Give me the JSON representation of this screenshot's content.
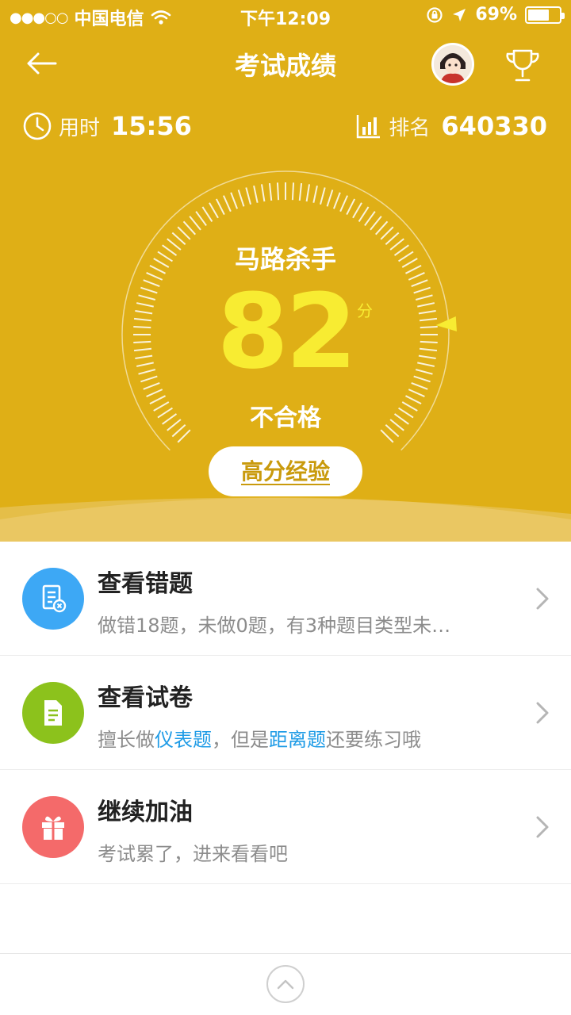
{
  "status_bar": {
    "carrier": "中国电信",
    "signal": "●●●○○",
    "time": "下午12:09",
    "battery": "69%",
    "battery_level": 0.69
  },
  "nav": {
    "title": "考试成绩"
  },
  "stats": {
    "time_label": "用时",
    "time_value": "15:56",
    "rank_label": "排名",
    "rank_value": "640330"
  },
  "result": {
    "level": "马路杀手",
    "score": "82",
    "score_unit": "分",
    "status": "不合格",
    "tips_button": "高分经验"
  },
  "list": [
    {
      "title": "查看错题",
      "desc_parts": [
        {
          "text": "做错18题，未做0题，有3种题目类型未…",
          "hl": false
        }
      ],
      "icon": "wrong-questions-icon",
      "color": "#3DA8F5"
    },
    {
      "title": "查看试卷",
      "desc_parts": [
        {
          "text": "擅长做",
          "hl": false
        },
        {
          "text": "仪表题",
          "hl": true
        },
        {
          "text": "，但是",
          "hl": false
        },
        {
          "text": "距离题",
          "hl": true
        },
        {
          "text": "还要练习哦",
          "hl": false
        }
      ],
      "icon": "paper-icon",
      "color": "#8CC21C"
    },
    {
      "title": "继续加油",
      "desc_parts": [
        {
          "text": "考试累了，进来看看吧",
          "hl": false
        }
      ],
      "icon": "gift-icon",
      "color": "#F46A6A"
    }
  ],
  "colors": {
    "header": "#DFAF16",
    "score": "#F8EC32",
    "highlight": "#1E9BE6"
  }
}
